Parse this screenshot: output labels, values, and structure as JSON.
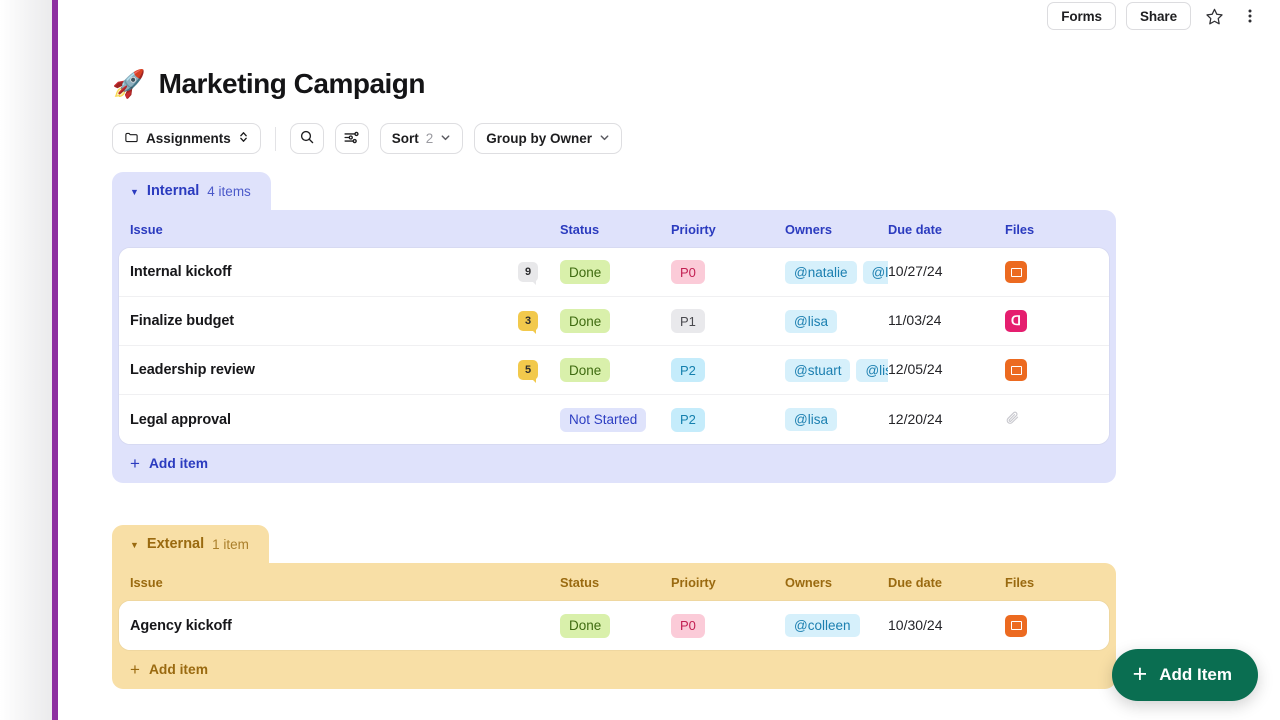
{
  "topbar": {
    "forms_label": "Forms",
    "share_label": "Share",
    "star_icon": "star-icon",
    "more_icon": "kebab-menu-icon"
  },
  "header": {
    "emoji": "🚀",
    "title": "Marketing Campaign"
  },
  "toolbar": {
    "view_label": "Assignments",
    "view_icon": "folder-icon",
    "selector_icon": "updown-chevrons-icon",
    "search_icon": "search-icon",
    "filter_icon": "filter-sliders-icon",
    "sort_label": "Sort",
    "sort_count": "2",
    "group_label": "Group by Owner",
    "chevron_icon": "chevron-down-icon"
  },
  "columns": [
    "Issue",
    "Status",
    "Prioirty",
    "Owners",
    "Due date",
    "Files"
  ],
  "groups": [
    {
      "name": "Internal",
      "count_label": "4 items",
      "accent": "#2b3bbf",
      "panel_color": "#dfe2fb",
      "add_item_label": "Add item",
      "rows": [
        {
          "issue": "Internal kickoff",
          "comments": "9",
          "comment_style": "grey",
          "status": "Done",
          "status_style": "done",
          "priority": "P0",
          "priority_style": "p0",
          "owners": [
            "@natalie",
            "@lisa"
          ],
          "due_date": "10/27/24",
          "file_icon": "powerpoint-file-icon"
        },
        {
          "issue": "Finalize budget",
          "comments": "3",
          "comment_style": "amber",
          "status": "Done",
          "status_style": "done",
          "priority": "P1",
          "priority_style": "p1",
          "owners": [
            "@lisa"
          ],
          "due_date": "11/03/24",
          "file_icon": "pdf-file-icon"
        },
        {
          "issue": "Leadership review",
          "comments": "5",
          "comment_style": "amber",
          "status": "Done",
          "status_style": "done",
          "priority": "P2",
          "priority_style": "p2",
          "owners": [
            "@stuart",
            "@lisa"
          ],
          "due_date": "12/05/24",
          "file_icon": "powerpoint-file-icon"
        },
        {
          "issue": "Legal approval",
          "comments": "",
          "comment_style": "none",
          "status": "Not Started",
          "status_style": "notstarted",
          "priority": "P2",
          "priority_style": "p2",
          "owners": [
            "@lisa"
          ],
          "due_date": "12/20/24",
          "file_icon": "paperclip-icon"
        }
      ]
    },
    {
      "name": "External",
      "count_label": "1 item",
      "accent": "#9a6a10",
      "panel_color": "#f8dfa6",
      "add_item_label": "Add item",
      "rows": [
        {
          "issue": "Agency kickoff",
          "comments": "",
          "comment_style": "none",
          "status": "Done",
          "status_style": "done",
          "priority": "P0",
          "priority_style": "p0",
          "owners": [
            "@colleen"
          ],
          "due_date": "10/30/24",
          "file_icon": "powerpoint-file-icon"
        }
      ]
    }
  ],
  "fab": {
    "label": "Add Item",
    "icon": "plus-icon",
    "color": "#0a6e51"
  }
}
